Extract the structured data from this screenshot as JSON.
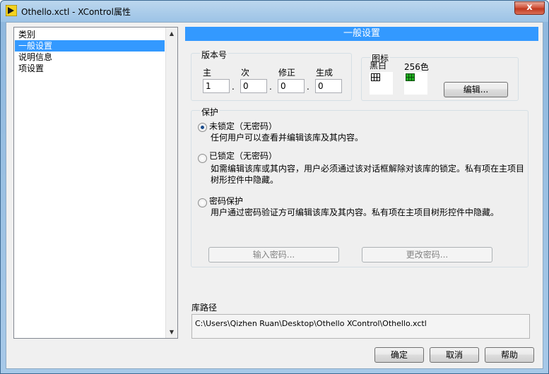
{
  "window": {
    "title": "Othello.xctl - XControl属性",
    "close_glyph": "x"
  },
  "categories": {
    "header": "类别",
    "items": [
      "一般设置",
      "说明信息",
      "项设置"
    ],
    "selected_index": 0
  },
  "section_header": "一般设置",
  "version": {
    "group_title": "版本号",
    "labels": [
      "主",
      "次",
      "修正",
      "生成"
    ],
    "values": [
      "1",
      "0",
      "0",
      "0"
    ],
    "separator": "."
  },
  "icon_group": {
    "title": "图标",
    "bw_label": "黑白",
    "color_label": "256色",
    "edit_button": "编辑..."
  },
  "protection": {
    "group_title": "保护",
    "options": [
      {
        "label": "未锁定（无密码）",
        "desc": "任何用户可以查看并编辑该库及其内容。",
        "checked": true
      },
      {
        "label": "已锁定（无密码）",
        "desc": "如需编辑该库或其内容，用户必须通过该对话框解除对该库的锁定。私有项在主项目树形控件中隐藏。",
        "checked": false
      },
      {
        "label": "密码保护",
        "desc": "用户通过密码验证方可编辑该库及其内容。私有项在主项目树形控件中隐藏。",
        "checked": false
      }
    ],
    "enter_password_button": "输入密码...",
    "change_password_button": "更改密码..."
  },
  "library_path": {
    "label": "库路径",
    "value": "C:\\Users\\Qizhen Ruan\\Desktop\\Othello XControl\\Othello.xctl"
  },
  "footer": {
    "ok": "确定",
    "cancel": "取消",
    "help": "帮助"
  },
  "colors": {
    "selection": "#3399ff",
    "close_button": "#c0391f"
  }
}
